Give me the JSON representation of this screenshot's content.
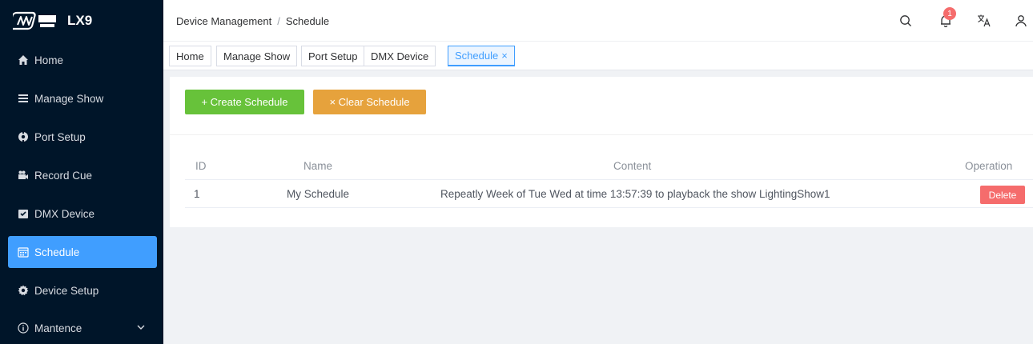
{
  "app": {
    "logo_text": "LX9"
  },
  "sidebar": {
    "items": [
      {
        "label": "Home",
        "icon": "home-icon"
      },
      {
        "label": "Manage Show",
        "icon": "list-icon"
      },
      {
        "label": "Port Setup",
        "icon": "port-icon"
      },
      {
        "label": "Record Cue",
        "icon": "record-icon"
      },
      {
        "label": "DMX Device",
        "icon": "device-icon"
      },
      {
        "label": "Schedule",
        "icon": "calendar-icon",
        "active": true
      },
      {
        "label": "Device Setup",
        "icon": "gear-icon"
      },
      {
        "label": "Mantence",
        "icon": "info-icon"
      }
    ]
  },
  "header": {
    "breadcrumb": [
      "Device Management",
      "Schedule"
    ],
    "breadcrumb_separator": "/",
    "notification_count": "1"
  },
  "tabs": [
    {
      "label": "Home"
    },
    {
      "label": "Manage Show"
    },
    {
      "label": "Port Setup"
    },
    {
      "label": "DMX Device"
    },
    {
      "label": "Schedule",
      "active": true,
      "close": "×"
    }
  ],
  "toolbar": {
    "create_label": "+ Create Schedule",
    "clear_label": "× Clear Schedule"
  },
  "table": {
    "columns": [
      "ID",
      "Name",
      "Content",
      "Operation"
    ],
    "rows": [
      {
        "id": "1",
        "name": "My Schedule",
        "content": "Repeatly Week of Tue Wed at time 13:57:39 to playback the show LightingShow1",
        "action": "Delete"
      }
    ]
  },
  "colors": {
    "sidebar_bg": "#001529",
    "accent": "#409eff",
    "success": "#67c23a",
    "warning": "#e6a23c",
    "danger": "#f56c6c"
  }
}
